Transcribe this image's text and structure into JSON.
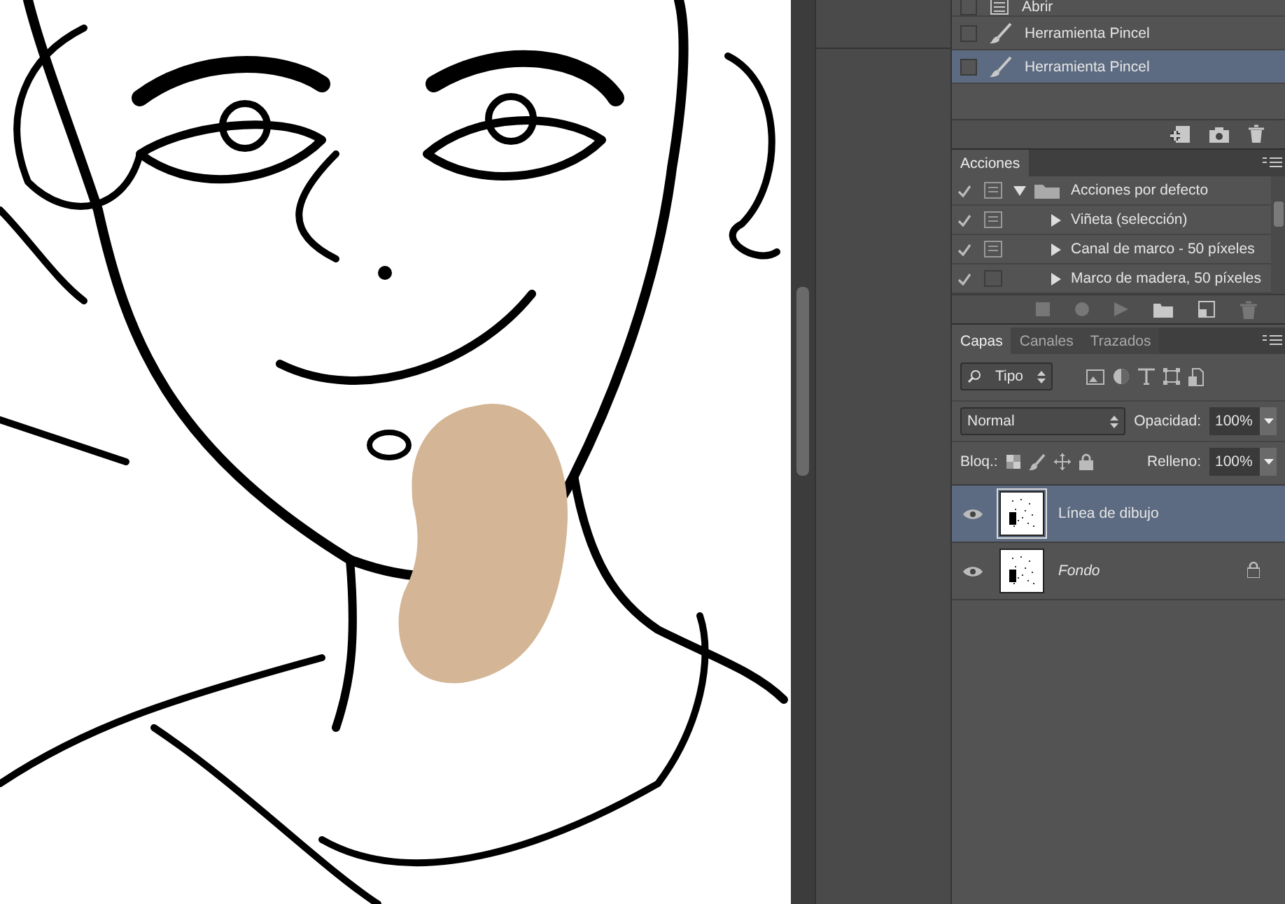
{
  "history": {
    "items": [
      {
        "kind": "document",
        "label": "Abrir",
        "selected": false
      },
      {
        "kind": "brush",
        "label": "Herramienta Pincel",
        "selected": false
      },
      {
        "kind": "brush",
        "label": "Herramienta Pincel",
        "selected": true
      }
    ]
  },
  "actions": {
    "tab": "Acciones",
    "items": [
      {
        "kind": "set",
        "label": "Acciones por defecto",
        "checked": true,
        "dialog": true,
        "expanded": true
      },
      {
        "kind": "action",
        "label": "Viñeta (selección)",
        "checked": true,
        "dialog": true,
        "expanded": false
      },
      {
        "kind": "action",
        "label": "Canal de marco - 50 píxeles",
        "checked": true,
        "dialog": true,
        "expanded": false
      },
      {
        "kind": "action",
        "label": "Marco de madera, 50 píxeles",
        "checked": true,
        "dialog": false,
        "expanded": false
      }
    ]
  },
  "layers": {
    "tabs": [
      {
        "label": "Capas",
        "selected": true
      },
      {
        "label": "Canales",
        "selected": false
      },
      {
        "label": "Trazados",
        "selected": false
      }
    ],
    "filter": "Tipo",
    "blend_mode": "Normal",
    "opacity_label": "Opacidad:",
    "opacity": "100%",
    "lock_label": "Bloq.:",
    "fill_label": "Relleno:",
    "fill": "100%",
    "items": [
      {
        "kind": "layer",
        "name": "Línea de dibujo",
        "visible": true,
        "selected": true,
        "locked": false
      },
      {
        "kind": "background",
        "name": "Fondo",
        "visible": true,
        "selected": false,
        "locked": true
      }
    ]
  }
}
